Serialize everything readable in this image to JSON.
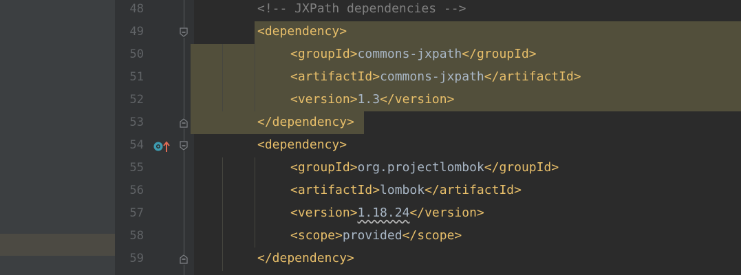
{
  "editor": {
    "lines": [
      {
        "number": "48",
        "indent": 1,
        "parts": [
          {
            "kind": "comment",
            "text": "<!-- JXPath dependencies -->"
          }
        ]
      },
      {
        "number": "49",
        "indent": 1,
        "fold": "open",
        "parts": [
          {
            "kind": "tag",
            "text": "<dependency>"
          }
        ]
      },
      {
        "number": "50",
        "indent": 2,
        "parts": [
          {
            "kind": "tag",
            "text": "<groupId>"
          },
          {
            "kind": "text",
            "text": "commons-jxpath"
          },
          {
            "kind": "tag",
            "text": "</groupId>"
          }
        ]
      },
      {
        "number": "51",
        "indent": 2,
        "parts": [
          {
            "kind": "tag",
            "text": "<artifactId>"
          },
          {
            "kind": "text",
            "text": "commons-jxpath"
          },
          {
            "kind": "tag",
            "text": "</artifactId>"
          }
        ]
      },
      {
        "number": "52",
        "indent": 2,
        "parts": [
          {
            "kind": "tag",
            "text": "<version>"
          },
          {
            "kind": "text",
            "text": "1.3"
          },
          {
            "kind": "tag",
            "text": "</version>"
          }
        ]
      },
      {
        "number": "53",
        "indent": 1,
        "fold": "close",
        "parts": [
          {
            "kind": "tag",
            "text": "</dependency>"
          }
        ]
      },
      {
        "number": "54",
        "indent": 1,
        "fold": "open",
        "markers": [
          "override-icon",
          "navigate-up-arrow-icon"
        ],
        "parts": [
          {
            "kind": "tag",
            "text": "<dependency>"
          }
        ]
      },
      {
        "number": "55",
        "indent": 2,
        "parts": [
          {
            "kind": "tag",
            "text": "<groupId>"
          },
          {
            "kind": "text",
            "text": "org.projectlombok"
          },
          {
            "kind": "tag",
            "text": "</groupId>"
          }
        ]
      },
      {
        "number": "56",
        "indent": 2,
        "parts": [
          {
            "kind": "tag",
            "text": "<artifactId>"
          },
          {
            "kind": "text",
            "text": "lombok"
          },
          {
            "kind": "tag",
            "text": "</artifactId>"
          }
        ]
      },
      {
        "number": "57",
        "indent": 2,
        "parts": [
          {
            "kind": "tag",
            "text": "<version>"
          },
          {
            "kind": "squiggle",
            "text": "1.18.24"
          },
          {
            "kind": "tag",
            "text": "</version>"
          }
        ]
      },
      {
        "number": "58",
        "indent": 2,
        "parts": [
          {
            "kind": "tag",
            "text": "<scope>"
          },
          {
            "kind": "text",
            "text": "provided"
          },
          {
            "kind": "tag",
            "text": "</scope>"
          }
        ]
      },
      {
        "number": "59",
        "indent": 1,
        "fold": "close",
        "parts": [
          {
            "kind": "tag",
            "text": "</dependency>"
          }
        ]
      }
    ]
  },
  "colors": {
    "background": "#2b2b2b",
    "gutter": "#313335",
    "highlight": "#524f3b",
    "tag": "#e8bf6a",
    "text": "#a9b7c6",
    "comment": "#808080",
    "line_number": "#606366"
  }
}
